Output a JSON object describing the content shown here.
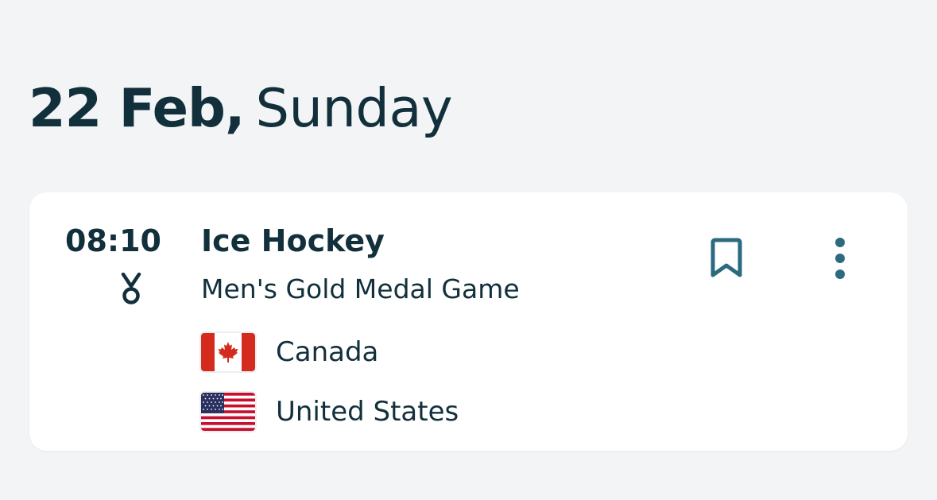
{
  "date_header": {
    "day_month": "22 Feb,",
    "weekday": "Sunday"
  },
  "event_card": {
    "time": "08:10",
    "medal_icon": "medal-icon",
    "sport": "Ice Hockey",
    "event_name": "Men's Gold Medal Game",
    "teams": [
      {
        "name": "Canada",
        "flag_icon": "canada-flag-icon"
      },
      {
        "name": "United States",
        "flag_icon": "usa-flag-icon"
      }
    ],
    "bookmark_icon": "bookmark-icon",
    "more_icon": "more-vertical-icon"
  },
  "colors": {
    "background": "#f3f4f6",
    "card": "#ffffff",
    "text": "#12303b",
    "icon_accent": "#2c6a80"
  }
}
